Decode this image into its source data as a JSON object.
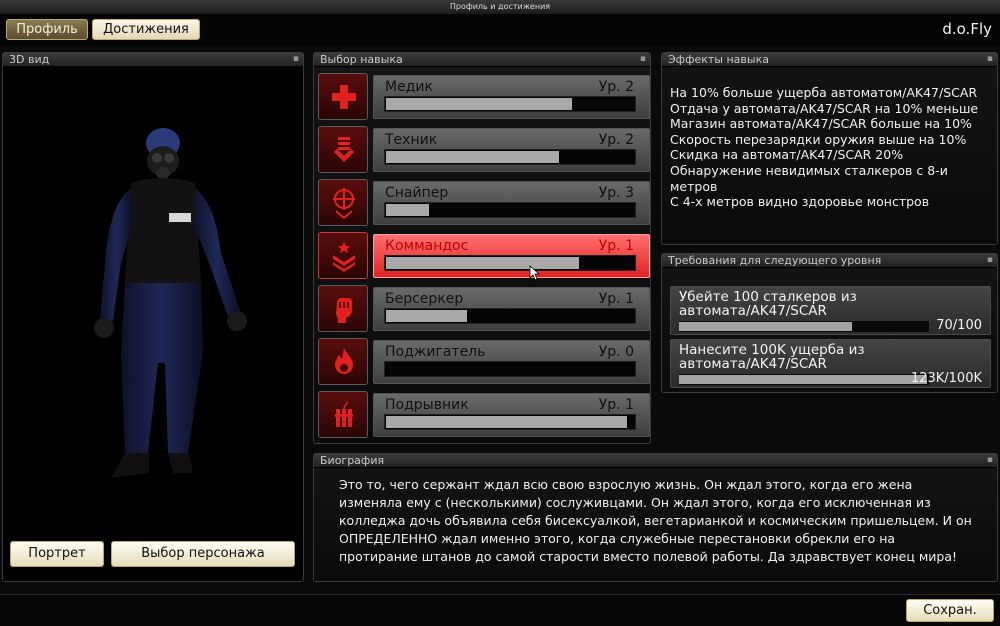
{
  "window": {
    "title": "Профиль и достижения"
  },
  "tabs": {
    "profile": "Профиль",
    "achievements": "Достижения"
  },
  "user": {
    "name": "d.o.Fly"
  },
  "view3d": {
    "title": "3D вид",
    "portrait_btn": "Портрет",
    "select_char_btn": "Выбор персонажа"
  },
  "skills": {
    "title": "Выбор навыка",
    "items": [
      {
        "name": "Медик",
        "level": "Ур. 2",
        "progress": 0.75,
        "icon": "medic-cross-icon"
      },
      {
        "name": "Техник",
        "level": "Ур. 2",
        "progress": 0.7,
        "icon": "technician-ammo-icon"
      },
      {
        "name": "Снайпер",
        "level": "Ур. 3",
        "progress": 0.18,
        "icon": "sniper-crosshair-icon"
      },
      {
        "name": "Коммандос",
        "level": "Ур. 1",
        "progress": 0.78,
        "icon": "commando-chevron-icon"
      },
      {
        "name": "Берсеркер",
        "level": "Ур. 1",
        "progress": 0.33,
        "icon": "berserker-fist-icon"
      },
      {
        "name": "Поджигатель",
        "level": "Ур. 0",
        "progress": 0.0,
        "icon": "arsonist-flame-icon"
      },
      {
        "name": "Подрывник",
        "level": "Ур. 1",
        "progress": 0.97,
        "icon": "demolition-dynamite-icon"
      }
    ]
  },
  "effects": {
    "title": "Эффекты навыка",
    "lines": [
      "На 10% больше ущерба автоматом/AK47/SCAR",
      "Отдача у автомата/AK47/SCAR на 10% меньше",
      "Магазин автомата/AK47/SCAR больше на 10%",
      "Скорость перезарядки оружия выше на 10%",
      "Скидка на автомат/AK47/SCAR 20%",
      "Обнаружение невидимых сталкеров с 8-и\nметров",
      "С 4-х метров видно здоровье монстров"
    ]
  },
  "requirements": {
    "title": "Требования для следующего уровня",
    "items": [
      {
        "text": "Убейте 100 сталкеров из автомата/AK47/SCAR",
        "count": "70/100",
        "progress": 0.7
      },
      {
        "text": "Нанесите 100K ущерба из автомата/AK47/SCAR",
        "count": "123K/100K",
        "progress": 1.0
      }
    ]
  },
  "bio": {
    "title": "Биография",
    "text": "Это то, чего сержант ждал всю свою взрослую жизнь.  Он ждал этого, когда его жена изменяла ему с (несколькими) сослуживцами. Он ждал этого, когда его исключенная из колледжа дочь объявила себя бисексуалкой, вегетарианкой и космическим пришельцем. И он ОПРЕДЕЛЕННО ждал именно этого, когда служебные перестановки обрекли его на протирание штанов до самой старости вместо полевой работы. Да здравствует конец мира!"
  },
  "footer": {
    "save_btn": "Сохран."
  },
  "colors": {
    "accent_red": "#e02424",
    "gold_border": "#b8a878"
  }
}
